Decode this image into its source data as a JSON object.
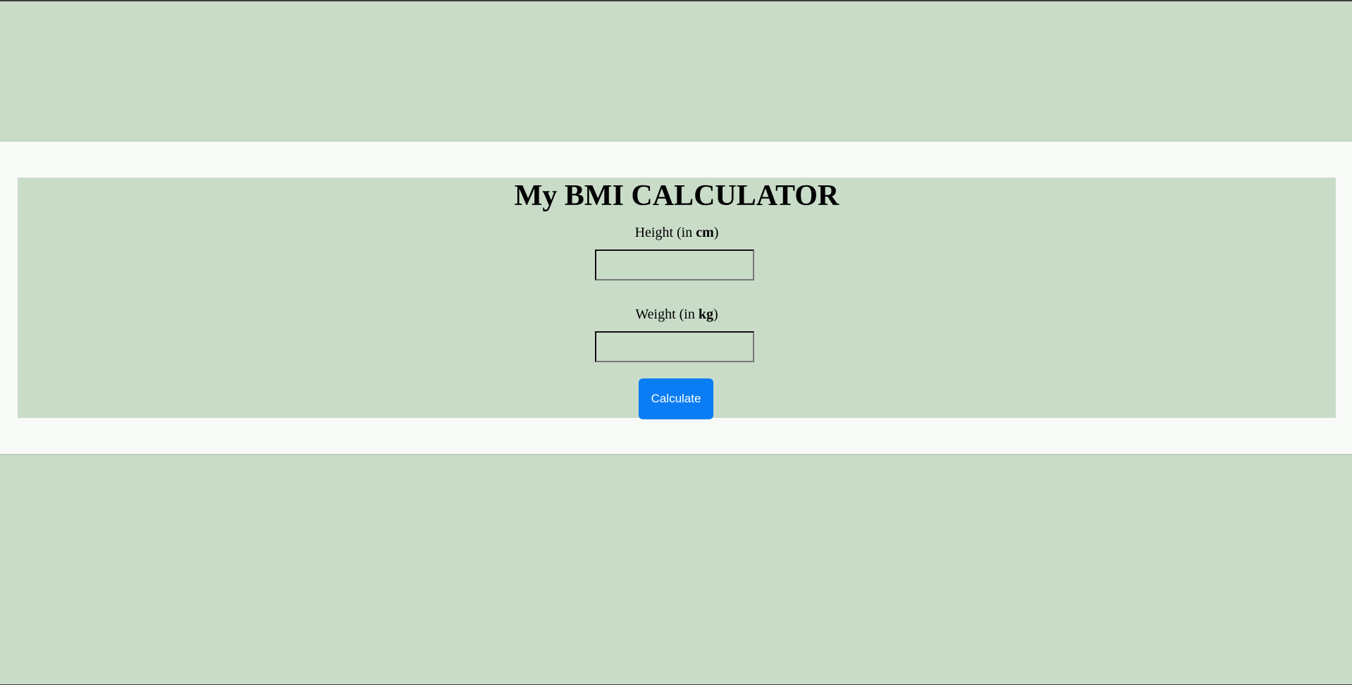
{
  "app": {
    "title": "My BMI CALCULATOR"
  },
  "form": {
    "height": {
      "label_prefix": "Height (in ",
      "label_unit": "cm",
      "label_suffix": ")",
      "value": "",
      "placeholder": ""
    },
    "weight": {
      "label_prefix": "Weight (in ",
      "label_unit": "kg",
      "label_suffix": ")",
      "value": "",
      "placeholder": ""
    },
    "calculate_label": "Calculate"
  },
  "colors": {
    "background": "#c9dcc8",
    "band": "#f8faf8",
    "accent": "#0a7df5"
  }
}
